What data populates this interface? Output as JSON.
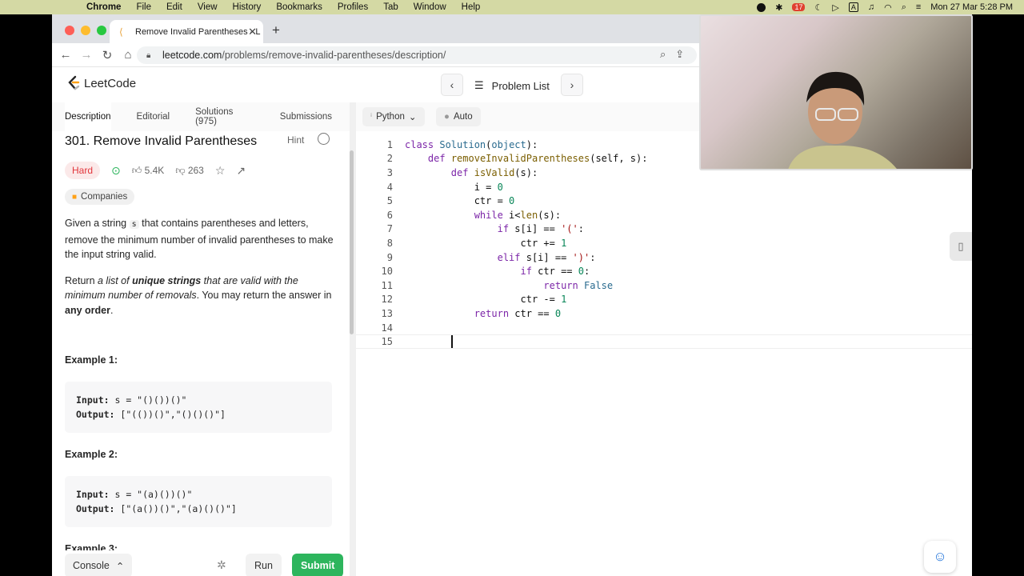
{
  "menubar": {
    "app": "Chrome",
    "items": [
      "File",
      "Edit",
      "View",
      "History",
      "Bookmarks",
      "Profiles",
      "Tab",
      "Window",
      "Help"
    ],
    "datetime": "Mon 27 Mar  5:28 PM",
    "badge": "17"
  },
  "browser": {
    "tab_title": "Remove Invalid Parentheses - L",
    "url_host": "leetcode.com",
    "url_path": "/problems/remove-invalid-parentheses/description/"
  },
  "header": {
    "logo": "LeetCode",
    "problem_list": "Problem List"
  },
  "left": {
    "tabs": [
      "Description",
      "Editorial",
      "Solutions (975)",
      "Submissions"
    ],
    "title": "301. Remove Invalid Parentheses",
    "hint": "Hint",
    "difficulty": "Hard",
    "likes": "5.4K",
    "dislikes": "263",
    "companies": "Companies",
    "p1_before": "Given a string ",
    "p1_code": "s",
    "p1_after": " that contains parentheses and letters, remove the minimum number of invalid parentheses to make the input string valid.",
    "p2_a": "Return ",
    "p2_b": "a list of ",
    "p2_c": "unique strings",
    "p2_d": " that are valid with the minimum number of removals",
    "p2_e": ". You may return the answer in ",
    "p2_f": "any order",
    "p2_g": ".",
    "examples": [
      {
        "heading": "Example 1:",
        "input_label": "Input:",
        "input": " s = \"()())()\"",
        "output_label": "Output:",
        "output": " [\"(())()\",\"()()()\"]"
      },
      {
        "heading": "Example 2:",
        "input_label": "Input:",
        "input": " s = \"(a)())()\"",
        "output_label": "Output:",
        "output": " [\"(a())()\",\"(a)()()\"]"
      },
      {
        "heading": "Example 3:"
      }
    ],
    "console": "Console",
    "run": "Run",
    "submit": "Submit"
  },
  "editor": {
    "language": "Python",
    "autosave": "Auto",
    "line_numbers": [
      "1",
      "2",
      "3",
      "4",
      "5",
      "6",
      "7",
      "8",
      "9",
      "10",
      "11",
      "12",
      "13",
      "14",
      "15"
    ]
  },
  "colors": {
    "hard": "#e2363c",
    "submit": "#2db55d",
    "brand": "#ffa116"
  }
}
